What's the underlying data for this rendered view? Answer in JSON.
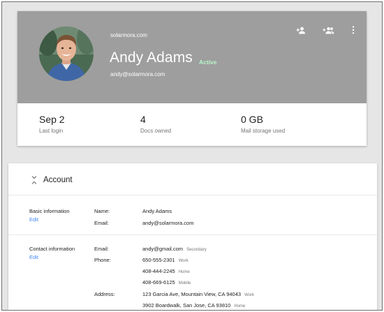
{
  "profile": {
    "domain": "solarmora.com",
    "name": "Andy Adams",
    "status": "Active",
    "email": "andy@solarmora.com",
    "status_color": "#b9f6ca",
    "header_color": "#9e9e9e",
    "actions": [
      {
        "icon": "add-person-icon"
      },
      {
        "icon": "add-group-icon"
      },
      {
        "icon": "more-vert-icon"
      }
    ]
  },
  "stats": [
    {
      "value": "Sep 2",
      "label": "Last login"
    },
    {
      "value": "4",
      "label": "Docs owned"
    },
    {
      "value": "0 GB",
      "label": "Mail storage used"
    }
  ],
  "account": {
    "title": "Account",
    "basic": {
      "label": "Basic information",
      "edit": "Edit",
      "name_label": "Name:",
      "name_value": "Andy Adams",
      "email_label": "Email:",
      "email_value": "andy@solarmora.com"
    },
    "contact": {
      "label": "Contact information",
      "edit": "Edit",
      "email_label": "Email:",
      "email_value": "andy@gmail.com",
      "email_type": "Secondary",
      "phone_label": "Phone:",
      "phones": [
        {
          "number": "650-555-2301",
          "type": "Work"
        },
        {
          "number": "408-444-2245",
          "type": "Home"
        },
        {
          "number": "408-669-6125",
          "type": "Mobile"
        }
      ],
      "address_label": "Address:",
      "addresses": [
        {
          "address": "123 Garcia Ave, Mountain View, CA 94043",
          "type": "Work"
        },
        {
          "address": "3902 Boardwalk, San Jose, CA 93810",
          "type": "Home"
        }
      ]
    },
    "link_color": "#4285f4"
  }
}
